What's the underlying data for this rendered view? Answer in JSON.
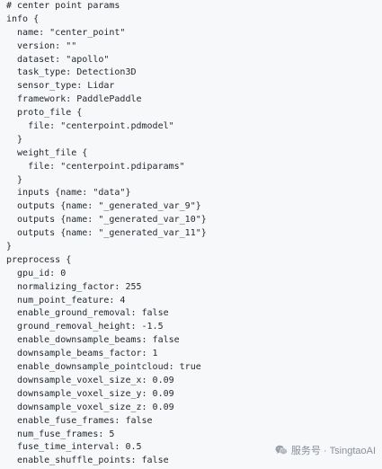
{
  "code": {
    "lines": [
      "# center point params",
      "info {",
      "  name: \"center_point\"",
      "  version: \"\"",
      "  dataset: \"apollo\"",
      "  task_type: Detection3D",
      "  sensor_type: Lidar",
      "  framework: PaddlePaddle",
      "  proto_file {",
      "    file: \"centerpoint.pdmodel\"",
      "  }",
      "  weight_file {",
      "    file: \"centerpoint.pdiparams\"",
      "  }",
      "  inputs {name: \"data\"}",
      "  outputs {name: \"_generated_var_9\"}",
      "  outputs {name: \"_generated_var_10\"}",
      "  outputs {name: \"_generated_var_11\"}",
      "}",
      "preprocess {",
      "  gpu_id: 0",
      "  normalizing_factor: 255",
      "  num_point_feature: 4",
      "  enable_ground_removal: false",
      "  ground_removal_height: -1.5",
      "  enable_downsample_beams: false",
      "  downsample_beams_factor: 1",
      "  enable_downsample_pointcloud: true",
      "  downsample_voxel_size_x: 0.09",
      "  downsample_voxel_size_y: 0.09",
      "  downsample_voxel_size_z: 0.09",
      "  enable_fuse_frames: false",
      "  num_fuse_frames: 5",
      "  fuse_time_interval: 0.5",
      "  enable_shuffle_points: false"
    ]
  },
  "watermark": {
    "text": "服务号 · TsingtaoAI",
    "icon": "wechat-icon"
  }
}
